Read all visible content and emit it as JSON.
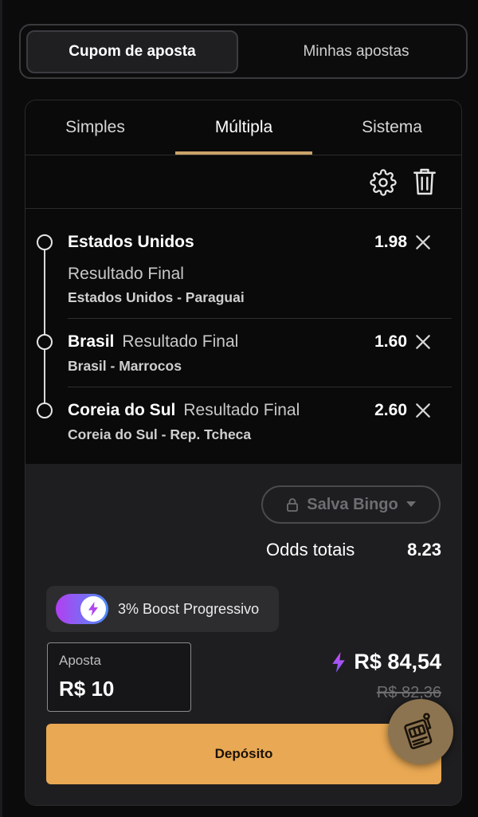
{
  "header": {
    "tabs": [
      {
        "label": "Cupom de aposta",
        "active": true
      },
      {
        "label": "Minhas apostas",
        "active": false
      }
    ]
  },
  "bet_type_tabs": [
    {
      "label": "Simples",
      "active": false
    },
    {
      "label": "Múltipla",
      "active": true
    },
    {
      "label": "Sistema",
      "active": false
    }
  ],
  "toolbar": {
    "settings_icon": "gear-icon",
    "delete_icon": "trash-icon"
  },
  "selections": [
    {
      "pick": "Estados Unidos",
      "market": "Resultado Final",
      "match": "Estados Unidos - Paraguai",
      "odds": "1.98"
    },
    {
      "pick": "Brasil",
      "market": "Resultado Final",
      "match": "Brasil - Marrocos",
      "odds": "1.60"
    },
    {
      "pick": "Coreia do Sul",
      "market": "Resultado Final",
      "match": "Coreia do Sul - Rep. Tcheca",
      "odds": "2.60"
    }
  ],
  "summary": {
    "salva_label": "Salva Bingo",
    "odds_label": "Odds totais",
    "odds_value": "8.23"
  },
  "boost": {
    "label": "3% Boost Progressivo",
    "enabled": true
  },
  "stake": {
    "label": "Aposta",
    "value": "R$ 10"
  },
  "payout": {
    "value": "R$ 84,54",
    "old_value": "R$ 82,36"
  },
  "deposit_label": "Depósito",
  "colors": {
    "accent": "#e9a853",
    "tab_underline": "#c9a36a",
    "boost_lightning": "#b044f0"
  }
}
